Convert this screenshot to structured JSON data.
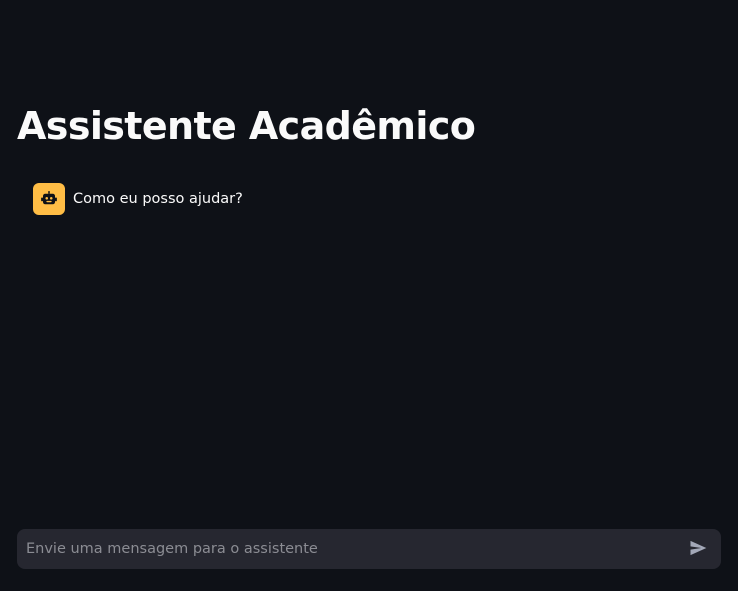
{
  "header": {
    "title": "Assistente Acadêmico"
  },
  "messages": [
    {
      "role": "assistant",
      "avatar_icon": "robot-face-icon",
      "avatar_color": "#ffbd45",
      "text": "Como eu posso ajudar?"
    }
  ],
  "chat_input": {
    "placeholder": "Envie uma mensagem para o assistente",
    "value": "",
    "send_icon": "send-icon"
  },
  "colors": {
    "background": "#0e1117",
    "input_background": "#262730",
    "text": "#fafafa",
    "placeholder": "#8b8c93",
    "accent": "#ffbd45"
  }
}
